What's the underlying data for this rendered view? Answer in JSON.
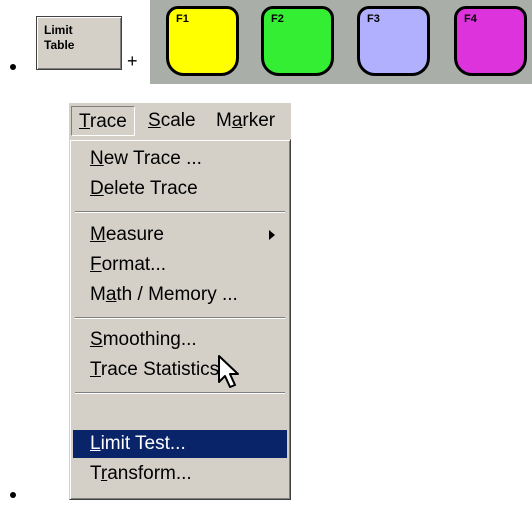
{
  "limit_button": {
    "label": "Limit\nTable"
  },
  "plus_sign": "+",
  "function_keys": [
    {
      "label": "F1",
      "color": "#ffff00"
    },
    {
      "label": "F2",
      "color": "#33ee33"
    },
    {
      "label": "F3",
      "color": "#b0b0ff"
    },
    {
      "label": "F4",
      "color": "#dd33dd"
    }
  ],
  "menubar": {
    "items": [
      {
        "label": "Trace",
        "underline_index": 0
      },
      {
        "label": "Scale",
        "underline_index": 0
      },
      {
        "label": "Marker",
        "underline_index": 1
      }
    ]
  },
  "trace_menu": {
    "items": [
      {
        "label": "New Trace ...",
        "underline_index": 0
      },
      {
        "label": "Delete Trace",
        "underline_index": 0
      },
      {
        "label": "Measure",
        "underline_index": 0,
        "submenu": true
      },
      {
        "label": "Format...",
        "underline_index": 0
      },
      {
        "label": "Math / Memory ...",
        "underline_index": 1
      },
      {
        "label": "Smoothing...",
        "underline_index": 0
      },
      {
        "label": "Trace Statistics...",
        "underline_index": 0
      },
      {
        "label": "Limit Test...",
        "underline_index": 0,
        "selected": true
      },
      {
        "label": "Transform...",
        "underline_index": 1
      }
    ]
  },
  "colors": {
    "menu_bg": "#d4d0c8",
    "selection": "#0a246a",
    "strip_bg": "#a9aea9"
  },
  "icons": {
    "cursor": "arrow-pointer-icon",
    "submenu": "submenu-arrow-icon"
  }
}
